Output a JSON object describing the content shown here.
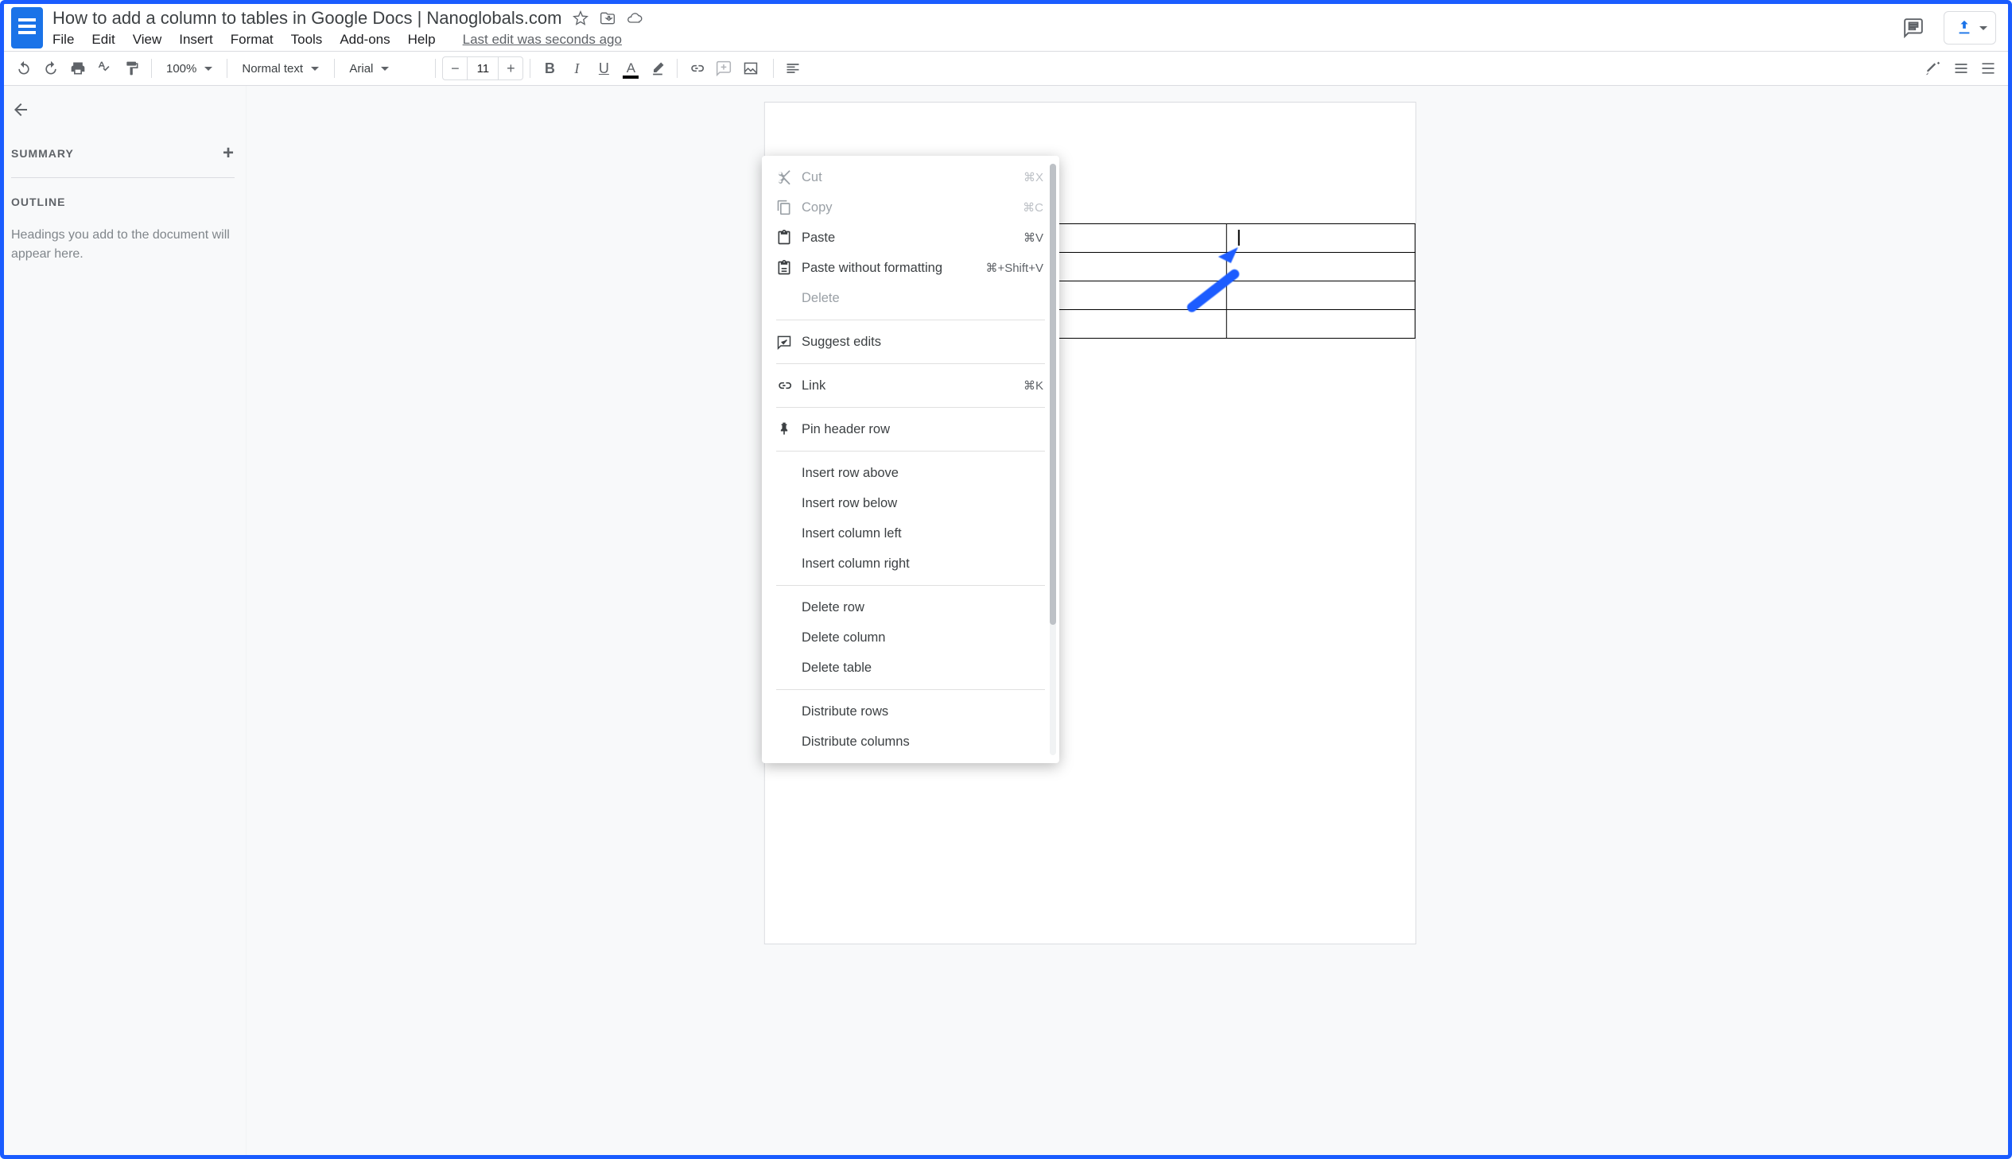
{
  "header": {
    "title": "How to add a column to tables in Google Docs | Nanoglobals.com",
    "menus": [
      "File",
      "Edit",
      "View",
      "Insert",
      "Format",
      "Tools",
      "Add-ons",
      "Help"
    ],
    "last_edit": "Last edit was seconds ago"
  },
  "toolbar": {
    "zoom": "100%",
    "style": "Normal text",
    "font": "Arial",
    "font_size": "11"
  },
  "sidebar": {
    "summary_label": "SUMMARY",
    "outline_label": "OUTLINE",
    "hint": "Headings you add to the document will appear here."
  },
  "table": {
    "rows": 4,
    "cols": 3
  },
  "context_menu": {
    "groups": [
      [
        {
          "id": "cut",
          "label": "Cut",
          "icon": "scissors",
          "shortcut": "⌘X",
          "disabled": true
        },
        {
          "id": "copy",
          "label": "Copy",
          "icon": "copy",
          "shortcut": "⌘C",
          "disabled": true
        },
        {
          "id": "paste",
          "label": "Paste",
          "icon": "paste",
          "shortcut": "⌘V",
          "disabled": false
        },
        {
          "id": "paste-no-fmt",
          "label": "Paste without formatting",
          "icon": "paste-plain",
          "shortcut": "⌘+Shift+V",
          "disabled": false
        },
        {
          "id": "delete",
          "label": "Delete",
          "icon": "",
          "shortcut": "",
          "disabled": true
        }
      ],
      [
        {
          "id": "suggest",
          "label": "Suggest edits",
          "icon": "suggest",
          "shortcut": "",
          "disabled": false
        }
      ],
      [
        {
          "id": "link",
          "label": "Link",
          "icon": "link",
          "shortcut": "⌘K",
          "disabled": false
        }
      ],
      [
        {
          "id": "pin-header",
          "label": "Pin header row",
          "icon": "pin",
          "shortcut": "",
          "disabled": false
        }
      ],
      [
        {
          "id": "row-above",
          "label": "Insert row above",
          "icon": "",
          "shortcut": "",
          "disabled": false
        },
        {
          "id": "row-below",
          "label": "Insert row below",
          "icon": "",
          "shortcut": "",
          "disabled": false
        },
        {
          "id": "col-left",
          "label": "Insert column left",
          "icon": "",
          "shortcut": "",
          "disabled": false
        },
        {
          "id": "col-right",
          "label": "Insert column right",
          "icon": "",
          "shortcut": "",
          "disabled": false
        }
      ],
      [
        {
          "id": "del-row",
          "label": "Delete row",
          "icon": "",
          "shortcut": "",
          "disabled": false
        },
        {
          "id": "del-col",
          "label": "Delete column",
          "icon": "",
          "shortcut": "",
          "disabled": false
        },
        {
          "id": "del-table",
          "label": "Delete table",
          "icon": "",
          "shortcut": "",
          "disabled": false
        }
      ],
      [
        {
          "id": "dist-rows",
          "label": "Distribute rows",
          "icon": "",
          "shortcut": "",
          "disabled": false
        },
        {
          "id": "dist-cols",
          "label": "Distribute columns",
          "icon": "",
          "shortcut": "",
          "disabled": false
        }
      ]
    ]
  }
}
